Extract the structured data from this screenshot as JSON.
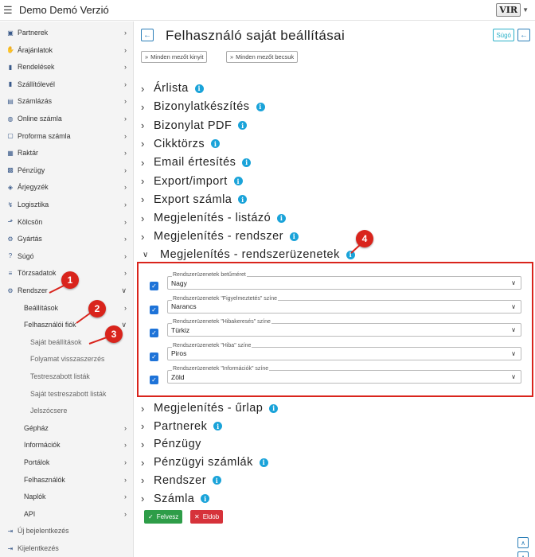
{
  "app": {
    "title": "Demo Demó Verzió",
    "logo_text": "VIR"
  },
  "sidebar": {
    "items": [
      {
        "label": "Partnerek",
        "icon": "address-card-icon",
        "glyph": "▣"
      },
      {
        "label": "Árajánlatok",
        "icon": "handshake-icon",
        "glyph": "✋"
      },
      {
        "label": "Rendelések",
        "icon": "file-icon",
        "glyph": "▮"
      },
      {
        "label": "Szállítólevél",
        "icon": "clipboard-icon",
        "glyph": "▮"
      },
      {
        "label": "Számlázás",
        "icon": "invoice-icon",
        "glyph": "▤"
      },
      {
        "label": "Online számla",
        "icon": "globe-icon",
        "glyph": "◍"
      },
      {
        "label": "Proforma számla",
        "icon": "document-icon",
        "glyph": "▢"
      },
      {
        "label": "Raktár",
        "icon": "warehouse-icon",
        "glyph": "▦"
      },
      {
        "label": "Pénzügy",
        "icon": "money-icon",
        "glyph": "▩"
      },
      {
        "label": "Árjegyzék",
        "icon": "tags-icon",
        "glyph": "◈"
      },
      {
        "label": "Logisztika",
        "icon": "dolly-icon",
        "glyph": "↯"
      },
      {
        "label": "Kölcsön",
        "icon": "hand-holding-icon",
        "glyph": "⬏"
      },
      {
        "label": "Gyártás",
        "icon": "cogs-icon",
        "glyph": "⚙"
      },
      {
        "label": "Súgó",
        "icon": "question-icon",
        "glyph": "?"
      },
      {
        "label": "Törzsadatok",
        "icon": "database-icon",
        "glyph": "≡"
      },
      {
        "label": "Rendszer",
        "icon": "gears-icon",
        "glyph": "⚙"
      }
    ],
    "sub1": [
      {
        "label": "Beállítások"
      },
      {
        "label": "Felhasználói fiók"
      }
    ],
    "sub2": [
      {
        "label": "Saját beállítások"
      },
      {
        "label": "Folyamat visszaszerzés"
      },
      {
        "label": "Testreszabott listák"
      },
      {
        "label": "Saját testreszabott listák"
      },
      {
        "label": "Jelszócsere"
      }
    ],
    "sub1b": [
      {
        "label": "Gépház"
      },
      {
        "label": "Információk"
      },
      {
        "label": "Portálok"
      },
      {
        "label": "Felhasználók"
      },
      {
        "label": "Naplók"
      },
      {
        "label": "API"
      }
    ],
    "bottom": [
      {
        "label": "Új bejelentkezés",
        "icon": "sign-in-icon"
      },
      {
        "label": "Kijelentkezés",
        "icon": "sign-out-icon"
      }
    ]
  },
  "header": {
    "title": "Felhasználó saját beállításai",
    "help_label": "Súgó",
    "expand_all": "Minden mezőt kinyit",
    "collapse_all": "Minden mezőt becsuk"
  },
  "sections_top": [
    "Árlista",
    "Bizonylatkészítés",
    "Bizonylat PDF",
    "Cikktörzs",
    "Email értesítés",
    "Export/import",
    "Export számla",
    "Megjelenítés - listázó",
    "Megjelenítés - rendszer"
  ],
  "open_section": "Megjelenítés - rendszerüzenetek",
  "fields": [
    {
      "label": "Rendszerüzenetek betűméret",
      "value": "Nagy"
    },
    {
      "label": "Rendszerüzenetek \"Figyelmeztetés\" színe",
      "value": "Narancs"
    },
    {
      "label": "Rendszerüzenetek \"Hibakeresés\" színe",
      "value": "Türkiz"
    },
    {
      "label": "Rendszerüzenetek \"Hiba\" színe",
      "value": "Piros"
    },
    {
      "label": "Rendszerüzenetek \"Információk\" színe",
      "value": "Zöld"
    }
  ],
  "sections_bottom": [
    "Megjelenítés - űrlap",
    "Partnerek",
    "Pénzügy",
    "Pénzügyi számlák",
    "Rendszer",
    "Számla"
  ],
  "sections_bottom_info": [
    true,
    true,
    false,
    true,
    true,
    true
  ],
  "actions": {
    "save": "Felvesz",
    "cancel": "Eldob"
  },
  "badges": [
    "1",
    "2",
    "3",
    "4"
  ],
  "colors": {
    "accent": "#2c7fb8",
    "info": "#1aa3d9",
    "highlight": "#d9241c",
    "save": "#2e9d48",
    "cancel": "#d6323a"
  }
}
